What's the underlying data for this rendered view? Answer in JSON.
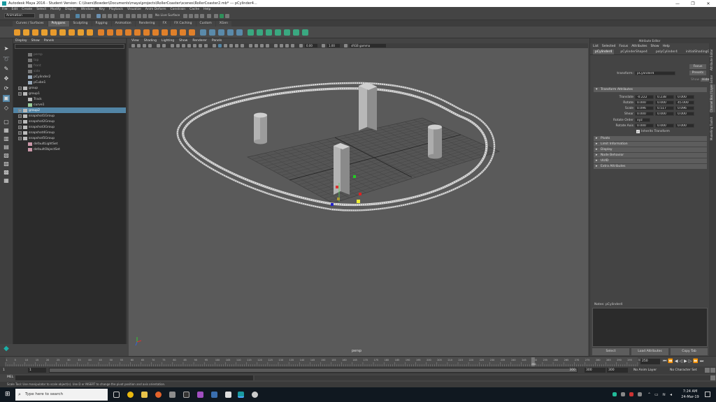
{
  "window": {
    "title": "Autodesk Maya 2016 - Student Version: C:\\Users\\Bowden\\Documents\\maya\\projects\\RollerCoaster\\scenes\\RollerCoaster2.mb* --- pCylinder4...",
    "minimize": "—",
    "maximize": "❐",
    "close": "✕"
  },
  "menubar": [
    "File",
    "Edit",
    "Create",
    "Select",
    "Modify",
    "Display",
    "Windows",
    "Key",
    "Playback",
    "Visualize",
    "Anim Deform",
    "Constrain",
    "Cache",
    "Help"
  ],
  "statusline": {
    "mode": "Animation",
    "live_surface": "No Live Surface"
  },
  "shelf_tabs": [
    "Curves / Surfaces",
    "Polygons",
    "Sculpting",
    "Rigging",
    "Animation",
    "Rendering",
    "FX",
    "FX Caching",
    "Custom",
    "XGen"
  ],
  "shelf_active": "Polygons",
  "outliner": {
    "menu": [
      "Display",
      "Show",
      "Panels"
    ],
    "items": [
      {
        "label": "persp",
        "dim": true,
        "expand": false,
        "icon": "camera"
      },
      {
        "label": "top",
        "dim": true,
        "expand": false,
        "icon": "camera"
      },
      {
        "label": "front",
        "dim": true,
        "expand": false,
        "icon": "camera"
      },
      {
        "label": "side",
        "dim": true,
        "expand": false,
        "icon": "camera"
      },
      {
        "label": "pCylinder2",
        "dim": false,
        "expand": false,
        "icon": "mesh"
      },
      {
        "label": "pCube1",
        "dim": false,
        "expand": false,
        "icon": "mesh"
      },
      {
        "label": "group",
        "dim": false,
        "expand": true,
        "icon": "group"
      },
      {
        "label": "group1",
        "dim": false,
        "expand": true,
        "icon": "group"
      },
      {
        "label": "Track",
        "dim": false,
        "expand": false,
        "icon": "group"
      },
      {
        "label": "curve1",
        "dim": false,
        "expand": false,
        "icon": "curve"
      },
      {
        "label": "group2",
        "dim": false,
        "expand": true,
        "icon": "group",
        "selected": true
      },
      {
        "label": "snapshot1Group",
        "dim": false,
        "expand": true,
        "icon": "group"
      },
      {
        "label": "snapshot2Group",
        "dim": false,
        "expand": true,
        "icon": "group"
      },
      {
        "label": "snapshot3Group",
        "dim": false,
        "expand": true,
        "icon": "group"
      },
      {
        "label": "snapshot4Group",
        "dim": false,
        "expand": true,
        "icon": "group"
      },
      {
        "label": "snapshot5Group",
        "dim": false,
        "expand": true,
        "icon": "group"
      },
      {
        "label": "defaultLightSet",
        "dim": false,
        "expand": false,
        "icon": "set"
      },
      {
        "label": "defaultObjectSet",
        "dim": false,
        "expand": false,
        "icon": "set"
      }
    ]
  },
  "viewport": {
    "menu": [
      "View",
      "Shading",
      "Lighting",
      "Show",
      "Renderer",
      "Panels"
    ],
    "field1": "0.00",
    "field2": "1.00",
    "colorspace": "sRGB gamma",
    "camera_label": "persp"
  },
  "attribute_editor": {
    "header": "Attribute Editor",
    "menu": [
      "List",
      "Selected",
      "Focus",
      "Attributes",
      "Show",
      "Help"
    ],
    "node_tabs": [
      "pCylinder4",
      "pCylinderShape4",
      "polyCylinder4",
      "initialShadingGr"
    ],
    "transform_label": "transform:",
    "transform_value": "pCylinder4",
    "focus": "Focus",
    "presets": "Presets",
    "show": "Show",
    "hide": "Hide",
    "section_transform": "Transform Attributes",
    "rows": [
      {
        "label": "Translate",
        "values": [
          "-0.222",
          "0.238",
          "0.000"
        ]
      },
      {
        "label": "Rotate",
        "values": [
          "0.000",
          "0.000",
          "45.000"
        ]
      },
      {
        "label": "Scale",
        "values": [
          "0.096",
          "0.517",
          "0.096"
        ]
      },
      {
        "label": "Shear",
        "values": [
          "0.000",
          "0.000",
          "0.000"
        ]
      }
    ],
    "rotate_order_label": "Rotate Order",
    "rotate_order": "xyz",
    "rotate_axis_label": "Rotate Axis",
    "rotate_axis": [
      "0.000",
      "0.000",
      "0.000"
    ],
    "inherits": "Inherits Transform",
    "sections": [
      "Pivots",
      "Limit Information",
      "Display",
      "Node Behavior",
      "UUID",
      "Extra Attributes"
    ],
    "notes": "Notes:  pCylinder4",
    "buttons": [
      "Select",
      "Load Attributes",
      "Copy Tab"
    ]
  },
  "side_tabs": [
    "Attribute Editor",
    "Channel Box / Layer Editor",
    "Modelling Toolkit"
  ],
  "time": {
    "ticks": [
      "1",
      "5",
      "10",
      "15",
      "20",
      "25",
      "30",
      "35",
      "40",
      "45",
      "50",
      "55",
      "60",
      "65",
      "70",
      "75",
      "80",
      "85",
      "90",
      "95",
      "100",
      "105",
      "110",
      "115",
      "120",
      "125",
      "130",
      "135",
      "140",
      "145",
      "150",
      "155",
      "160",
      "165",
      "170",
      "175",
      "180",
      "185",
      "190",
      "195",
      "200",
      "205",
      "210",
      "215",
      "220",
      "225",
      "230",
      "235",
      "240",
      "245",
      "250",
      "255",
      "260",
      "265",
      "270",
      "275",
      "280",
      "285",
      "290",
      "295",
      "300"
    ],
    "current_frame": "250",
    "current_field": "250",
    "range_start": "1",
    "range_start2": "1",
    "range_end": "300",
    "range_end2": "300",
    "range_end3": "300",
    "anim_layer": "No Anim Layer",
    "char_set": "No Character Set"
  },
  "cmd": {
    "lang": "MEL"
  },
  "help": "Scale Tool: Use manipulator to scale object(s). Use D or INSERT to change the pivot position and axis orientation.",
  "taskbar": {
    "search": "Type here to search",
    "time": "7:24 AM",
    "date": "24-Mar-19"
  }
}
